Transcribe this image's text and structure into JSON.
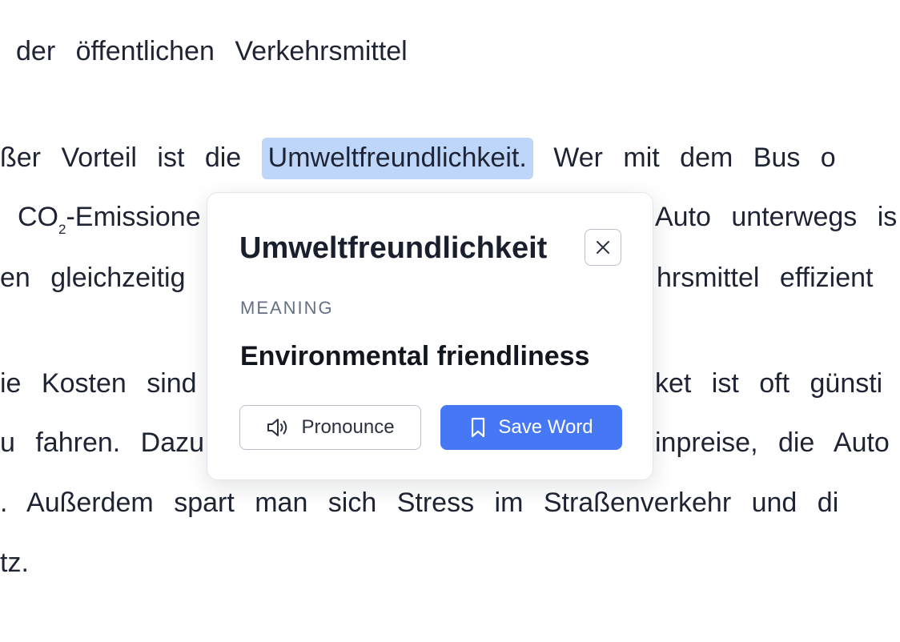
{
  "reading": {
    "line1": "der öffentlichen Verkehrsmittel",
    "line2_before": "ßer Vorteil ist die",
    "line2_highlight": "Umweltfreundlichkeit.",
    "line2_after": "Wer mit dem Bus o",
    "line3_before": "CO",
    "line3_sub": "2",
    "line3_mid": "-Emissione",
    "line3_after": "Auto unterwegs is",
    "line4_left": "en gleichzeitig",
    "line4_right": "hrsmittel effizient",
    "line5_left": "ie Kosten sind",
    "line5_right": "ket ist oft günsti",
    "line6_left": "u fahren. Dazu",
    "line6_right": "inpreise, die Auto",
    "line7": ". Außerdem spart man sich Stress im Straßenverkehr und di",
    "line8": "tz."
  },
  "popup": {
    "word": "Umweltfreundlichkeit",
    "meaning_label": "MEANING",
    "meaning": "Environmental friendliness",
    "pronounce_label": "Pronounce",
    "save_label": "Save Word",
    "close_icon": "close-icon",
    "speaker_icon": "speaker-icon",
    "bookmark_icon": "bookmark-icon"
  },
  "colors": {
    "highlight": "#bfd6fb",
    "primary": "#4678f5",
    "text": "#1e2433",
    "muted": "#667085"
  }
}
